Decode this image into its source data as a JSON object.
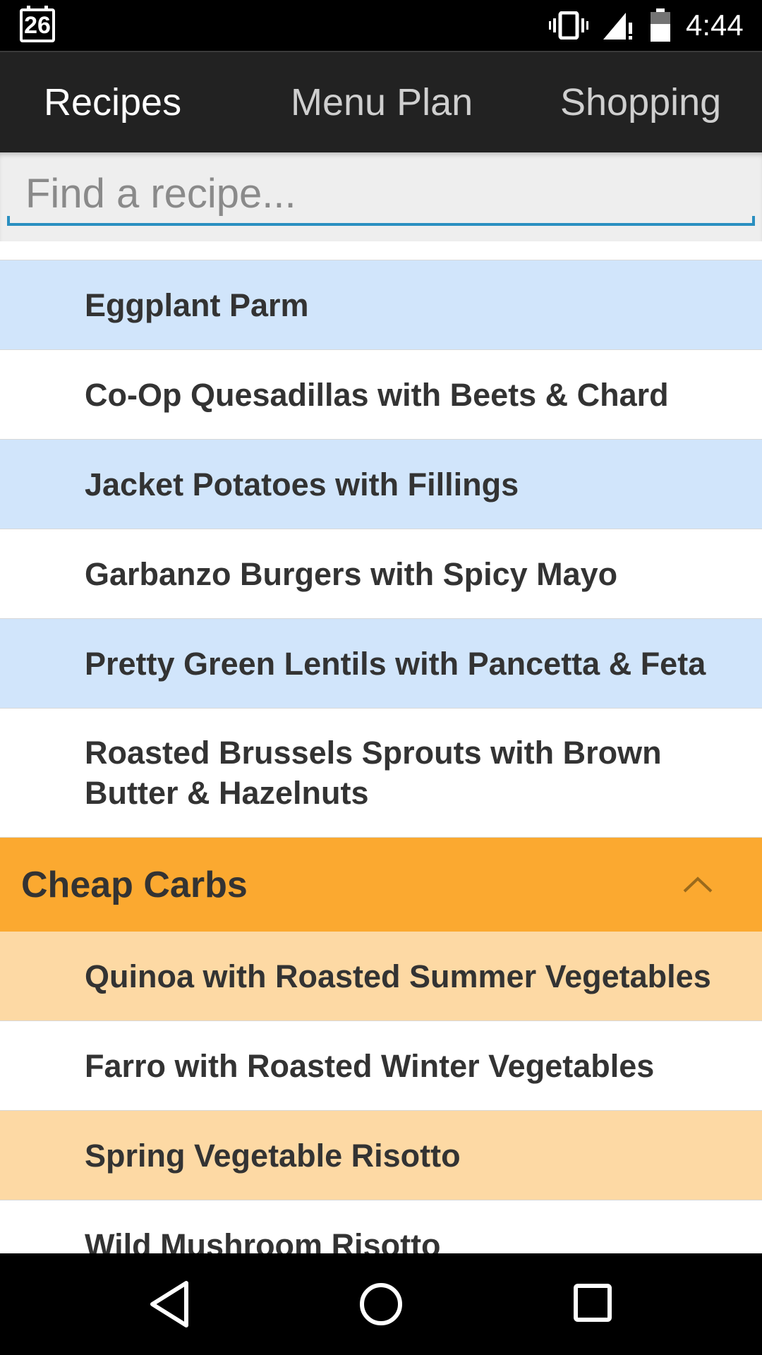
{
  "status_bar": {
    "calendar_day": "26",
    "time": "4:44",
    "icons": [
      "calendar-icon",
      "vibrate-icon",
      "signal-icon",
      "battery-icon"
    ]
  },
  "tabs": [
    {
      "label": "Recipes",
      "active": true
    },
    {
      "label": "Menu Plan",
      "active": false
    },
    {
      "label": "Shopping",
      "active": false
    }
  ],
  "search": {
    "placeholder": "Find a recipe...",
    "value": ""
  },
  "recipes": [
    {
      "name": "Eggplant Parm"
    },
    {
      "name": "Co-Op Quesadillas with Beets & Chard"
    },
    {
      "name": "Jacket Potatoes with Fillings"
    },
    {
      "name": "Garbanzo Burgers with Spicy Mayo"
    },
    {
      "name": "Pretty Green Lentils with Pancetta & Feta"
    },
    {
      "name": "Roasted Brussels Sprouts with Brown Butter & Hazelnuts"
    }
  ],
  "category": {
    "title": "Cheap Carbs",
    "expanded_icon": "chevron-up-icon"
  },
  "category_recipes": [
    {
      "name": "Quinoa with Roasted Summer Vegetables"
    },
    {
      "name": "Farro with Roasted Winter Vegetables"
    },
    {
      "name": "Spring Vegetable Risotto"
    },
    {
      "name": "Wild Mushroom Risotto"
    }
  ],
  "colors": {
    "tab_bar": "#222222",
    "search_underline": "#2a8fc0",
    "row_blue": "#d1e5fb",
    "category_header": "#fba930",
    "row_orange": "#fdd9a4"
  },
  "nav_bar": {
    "buttons": [
      "back-icon",
      "home-icon",
      "recents-icon"
    ]
  }
}
